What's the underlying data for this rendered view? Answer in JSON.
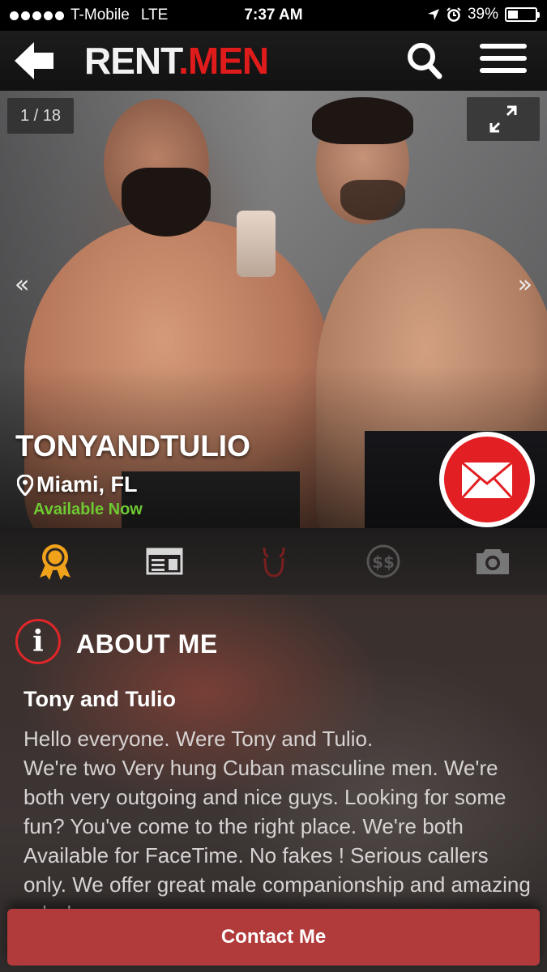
{
  "status_bar": {
    "carrier": "T-Mobile",
    "network": "LTE",
    "time": "7:37 AM",
    "battery": "39%",
    "battery_level": 0.39
  },
  "header": {
    "logo_part1": "RENT",
    "logo_dot": ".",
    "logo_part2": "MEN",
    "back_icon": "arrow-left-icon",
    "search_icon": "search-icon",
    "menu_icon": "hamburger-menu-icon"
  },
  "gallery": {
    "counter": "1 / 18",
    "prev_glyph": "«",
    "next_glyph": "»",
    "expand_icon": "expand-icon"
  },
  "profile": {
    "username": "TONYANDTULIO",
    "location": "Miami, FL",
    "availability": "Available Now",
    "mail_icon": "envelope-icon"
  },
  "tabs": [
    {
      "icon": "award-ribbon-icon",
      "color": "#f0a21b"
    },
    {
      "icon": "id-card-icon",
      "color": "#d8d8d8"
    },
    {
      "icon": "devil-icon",
      "color": "#7a1f1f"
    },
    {
      "icon": "dollar-coin-icon",
      "color": "#555555"
    },
    {
      "icon": "camera-icon",
      "color": "#777777"
    }
  ],
  "about": {
    "title": "ABOUT ME",
    "name": "Tony and Tulio",
    "text": "Hello everyone. Were Tony and Tulio.\nWe're two Very hung Cuban masculine men. We're both very outgoing and nice guys. Looking for some fun? You've come to the right place. We're both Available for FaceTime. No fakes ! Serious callers only. We offer great male companionship and amazing rub downs."
  },
  "contact_button": "Contact Me",
  "colors": {
    "brand_red": "#e01b1b",
    "available_green": "#6ec932",
    "contact_button": "#b13a3b"
  }
}
